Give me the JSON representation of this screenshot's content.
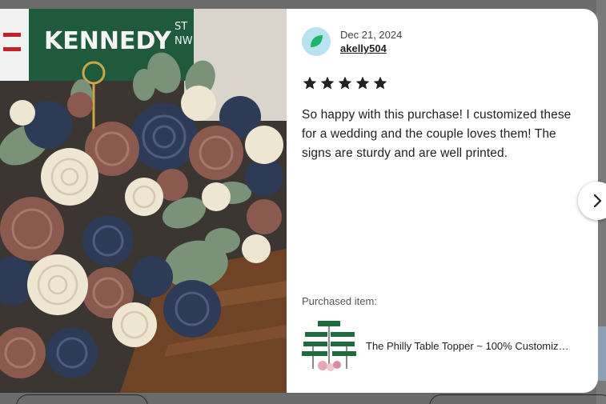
{
  "review": {
    "date": "Dec 21, 2024",
    "reviewer": "akelly504",
    "rating": 5,
    "text": "So happy with this purchase! I customized these for a wedding and the couple loves them! The signs are sturdy and are well printed."
  },
  "photo": {
    "sign_text": "KENNEDY",
    "sign_suffix_top": "ST",
    "sign_suffix_bottom": "NW"
  },
  "purchased": {
    "label": "Purchased item:",
    "title": "The Philly Table Topper ~ 100% Customiz…"
  },
  "icons": {
    "avatar": "leaf-avatar-icon",
    "star": "star-icon",
    "next": "chevron-right-icon"
  },
  "colors": {
    "star": "#222222",
    "avatar_bg": "#b8e2f0",
    "avatar_leaf": "#1db36a",
    "sign_green": "#1f5a3c"
  }
}
